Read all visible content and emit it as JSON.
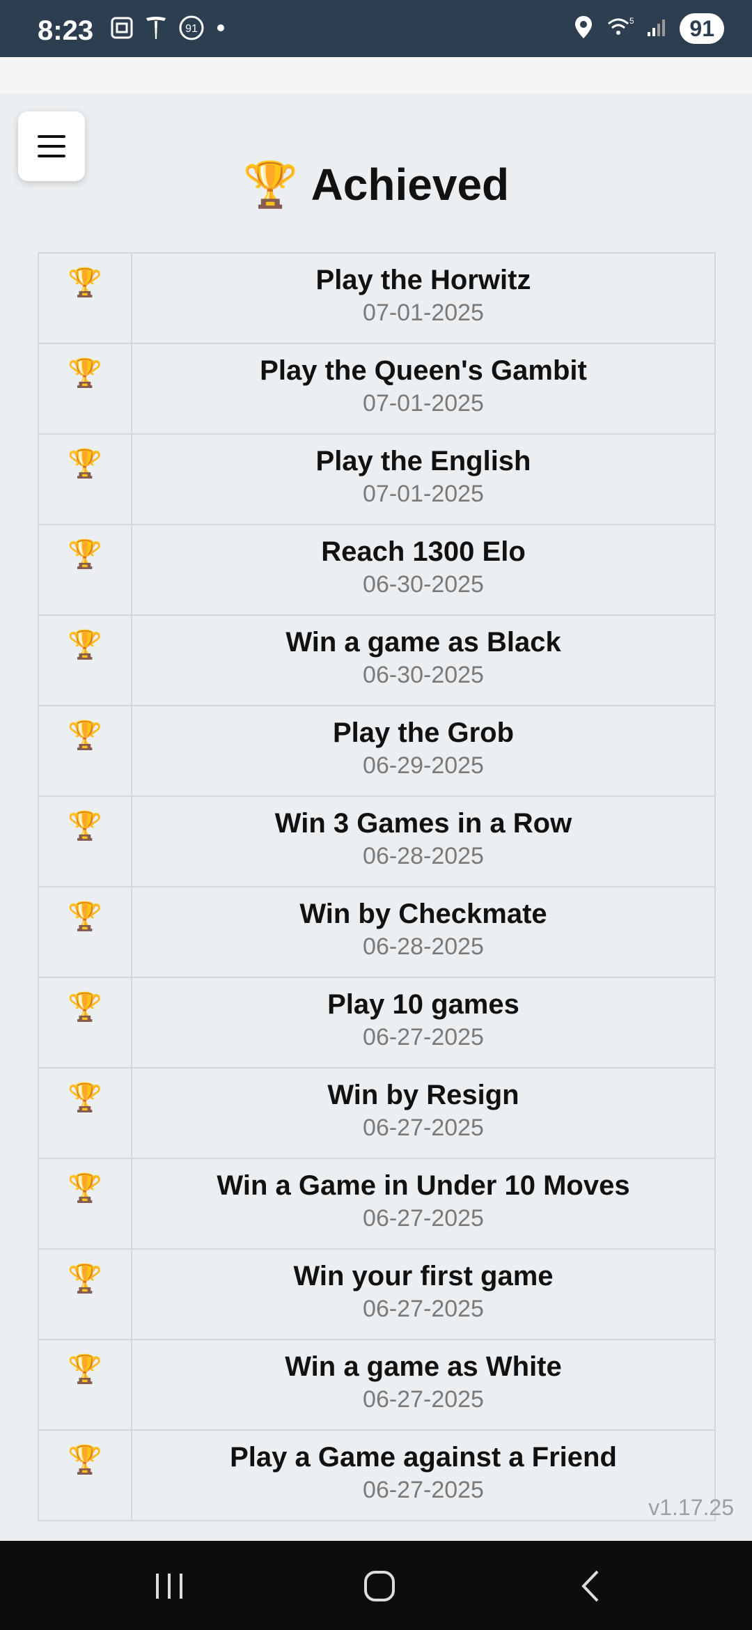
{
  "status_bar": {
    "time": "8:23",
    "left_icons": [
      "screenshot-icon",
      "tesla-icon",
      "notification-91-icon",
      "dot-icon"
    ],
    "badge_91": "91",
    "right_icons": [
      "location-icon",
      "wifi-icon",
      "signal-icon"
    ],
    "wifi_label": "5",
    "battery": "91"
  },
  "header": {
    "menu_icon": "hamburger-menu-icon",
    "title_icon": "🏆",
    "title": "Achieved"
  },
  "achievements": [
    {
      "icon": "🏆",
      "name": "Play the Horwitz",
      "date": "07-01-2025"
    },
    {
      "icon": "🏆",
      "name": "Play the Queen's Gambit",
      "date": "07-01-2025"
    },
    {
      "icon": "🏆",
      "name": "Play the English",
      "date": "07-01-2025"
    },
    {
      "icon": "🏆",
      "name": "Reach 1300 Elo",
      "date": "06-30-2025"
    },
    {
      "icon": "🏆",
      "name": "Win a game as Black",
      "date": "06-30-2025"
    },
    {
      "icon": "🏆",
      "name": "Play the Grob",
      "date": "06-29-2025"
    },
    {
      "icon": "🏆",
      "name": "Win 3 Games in a Row",
      "date": "06-28-2025"
    },
    {
      "icon": "🏆",
      "name": "Win by Checkmate",
      "date": "06-28-2025"
    },
    {
      "icon": "🏆",
      "name": "Play 10 games",
      "date": "06-27-2025"
    },
    {
      "icon": "🏆",
      "name": "Win by Resign",
      "date": "06-27-2025"
    },
    {
      "icon": "🏆",
      "name": "Win a Game in Under 10 Moves",
      "date": "06-27-2025"
    },
    {
      "icon": "🏆",
      "name": "Win your first game",
      "date": "06-27-2025"
    },
    {
      "icon": "🏆",
      "name": "Win a game as White",
      "date": "06-27-2025"
    },
    {
      "icon": "🏆",
      "name": "Play a Game against a Friend",
      "date": "06-27-2025"
    }
  ],
  "version": "v1.17.25",
  "nav_bar": {
    "recents_icon": "recent-apps-icon",
    "home_icon": "home-icon",
    "back_icon": "back-icon"
  }
}
